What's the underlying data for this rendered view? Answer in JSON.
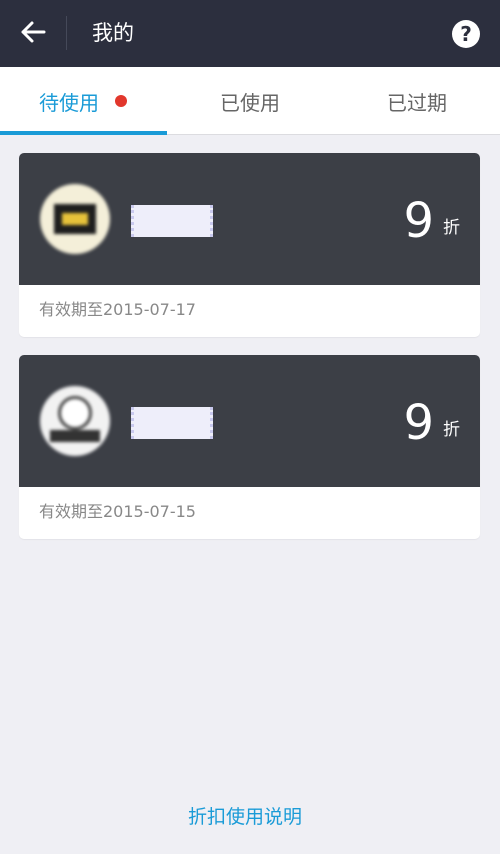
{
  "header": {
    "title": "我的",
    "back_icon": "back-arrow-icon",
    "help_icon": "help-icon",
    "help_label": "?"
  },
  "tabs": [
    {
      "label": "待使用",
      "active": true,
      "has_badge": true
    },
    {
      "label": "已使用",
      "active": false,
      "has_badge": false
    },
    {
      "label": "已过期",
      "active": false,
      "has_badge": false
    }
  ],
  "coupons": [
    {
      "discount": "9",
      "unit": "折",
      "validity": "有效期至2015-07-17"
    },
    {
      "discount": "9",
      "unit": "折",
      "validity": "有效期至2015-07-15"
    }
  ],
  "footer": {
    "link_label": "折扣使用说明"
  },
  "colors": {
    "header_bg": "#2c2f3e",
    "accent": "#1a9bd7",
    "badge": "#e2372c",
    "card_top": "#3c3f46",
    "page_bg": "#efeff4"
  }
}
